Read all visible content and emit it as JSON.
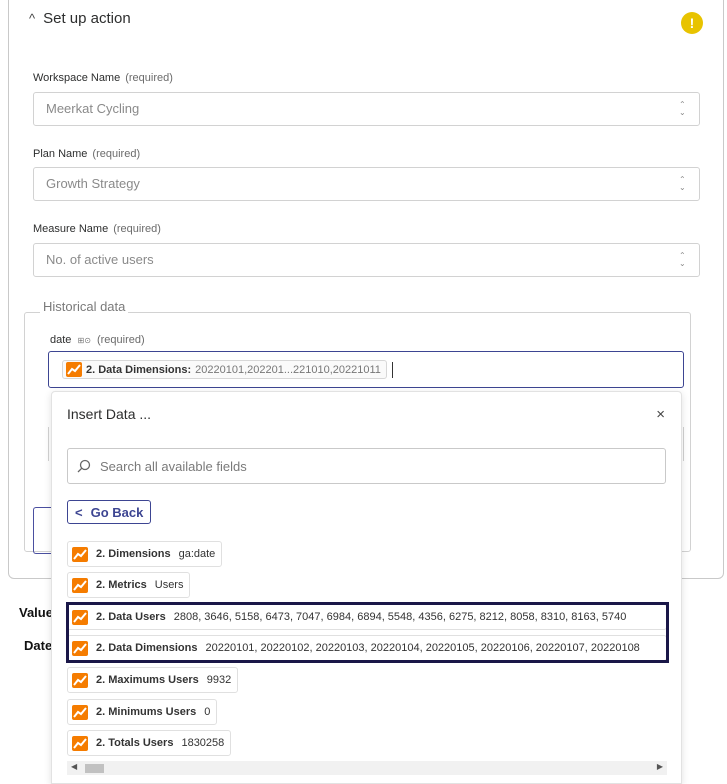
{
  "panel": {
    "title": "Set up action",
    "chevron": "^",
    "warning_symbol": "!"
  },
  "fields": {
    "workspace": {
      "label": "Workspace Name",
      "required": "(required)",
      "value": "Meerkat Cycling"
    },
    "plan": {
      "label": "Plan Name",
      "required": "(required)",
      "value": "Growth Strategy"
    },
    "measure": {
      "label": "Measure Name",
      "required": "(required)",
      "value": "No. of active users"
    }
  },
  "historical": {
    "legend": "Historical data",
    "date_label": "date",
    "date_hint_icons": "⊞⊙",
    "date_required": "(required)",
    "pill_key": "2. Data Dimensions:",
    "pill_value": "20220101,202201...221010,20221011"
  },
  "popup": {
    "title": "Insert Data ...",
    "close": "×",
    "search_placeholder": "Search all available fields",
    "go_back": "Go Back",
    "go_back_chevron": "<",
    "items": [
      {
        "key": "2. Dimensions",
        "value": "ga:date"
      },
      {
        "key": "2. Metrics",
        "value": "Users"
      },
      {
        "key": "2. Data Users",
        "value": "2808, 3646, 5158, 6473, 7047, 6984, 6894, 5548, 4356, 6275, 8212, 8058, 8310, 8163, 5740"
      },
      {
        "key": "2. Data Dimensions",
        "value": "20220101, 20220102, 20220103, 20220104, 20220105, 20220106, 20220107, 20220108"
      },
      {
        "key": "2. Maximums Users",
        "value": "9932"
      },
      {
        "key": "2. Minimums Users",
        "value": "0"
      },
      {
        "key": "2. Totals Users",
        "value": "1830258"
      }
    ]
  },
  "annotations": {
    "value": "Value",
    "date": "Date"
  },
  "scrollbar": {
    "left": "◀",
    "right": "▶"
  },
  "colors": {
    "accent": "#3d4592",
    "warning": "#e8c300",
    "highlight_border": "#1a1748",
    "ga_orange": "#f57c00"
  }
}
